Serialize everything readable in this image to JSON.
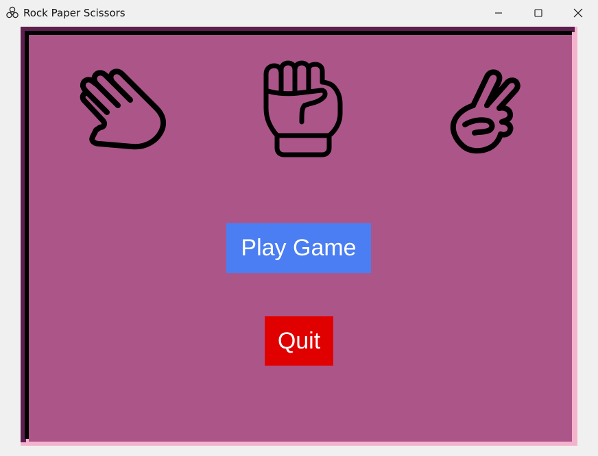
{
  "window": {
    "title": "Rock Paper Scissors",
    "app_icon": "biohazard-icon",
    "controls": [
      "minimize-icon",
      "maximize-icon",
      "close-icon"
    ]
  },
  "game": {
    "choices": [
      {
        "name": "paper",
        "icon": "open-hand-icon"
      },
      {
        "name": "rock",
        "icon": "fist-icon"
      },
      {
        "name": "scissors",
        "icon": "victory-hand-icon"
      }
    ],
    "play_label": "Play Game",
    "quit_label": "Quit"
  },
  "colors": {
    "canvas_bg": "#ac5589",
    "play_button": "#4a7ef2",
    "quit_button": "#e00000",
    "border_light": "#f4b3cd",
    "border_dark": "#5e1f4e"
  }
}
